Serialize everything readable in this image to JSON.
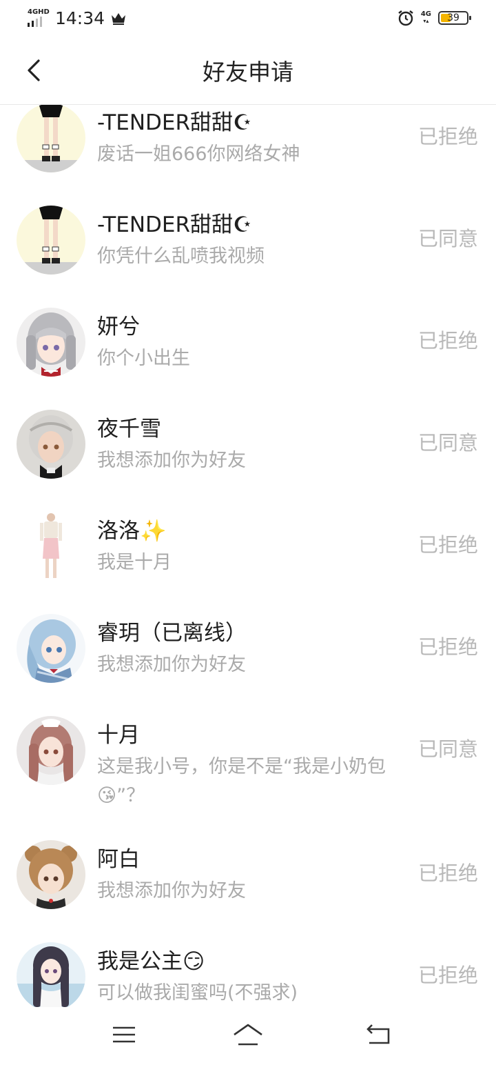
{
  "status_bar": {
    "network_left": "4GHD",
    "time": "14:34",
    "network_right": "4G",
    "battery_percent": 39,
    "battery_label": "39",
    "battery_color": "#f4b400"
  },
  "header": {
    "title": "好友申请",
    "back_icon": "chevron-left-icon"
  },
  "requests": [
    {
      "name": "-TENDER甜甜☪",
      "message": "废话一姐666你网络女神",
      "status": "已拒绝",
      "avatar": "figure-legs"
    },
    {
      "name": "-TENDER甜甜☪",
      "message": "你凭什么乱喷我视频",
      "status": "已同意",
      "avatar": "figure-legs"
    },
    {
      "name": "妍兮",
      "message": "你个小出生",
      "status": "已拒绝",
      "avatar": "girl-silver"
    },
    {
      "name": "夜千雪",
      "message": "我想添加你为好友",
      "status": "已同意",
      "avatar": "girl-silver-dark"
    },
    {
      "name": "洛洛✨",
      "message": "我是十月",
      "status": "已拒绝",
      "avatar": "figure-dress"
    },
    {
      "name": "睿玥（已离线）",
      "message": "我想添加你为好友",
      "status": "已拒绝",
      "avatar": "girl-blue"
    },
    {
      "name": "十月",
      "message": "这是我小号，你是不是“我是小奶包😘”？",
      "status": "已同意",
      "avatar": "girl-pink"
    },
    {
      "name": "阿白",
      "message": "我想添加你为好友",
      "status": "已拒绝",
      "avatar": "girl-bear"
    },
    {
      "name": "我是公主😏",
      "message": "可以做我闺蜜吗(不强求)",
      "status": "已拒绝",
      "avatar": "girl-dark-hair"
    }
  ],
  "nav_bar": {
    "menu_icon": "menu-icon",
    "home_icon": "home-icon",
    "back_icon": "back-icon"
  }
}
